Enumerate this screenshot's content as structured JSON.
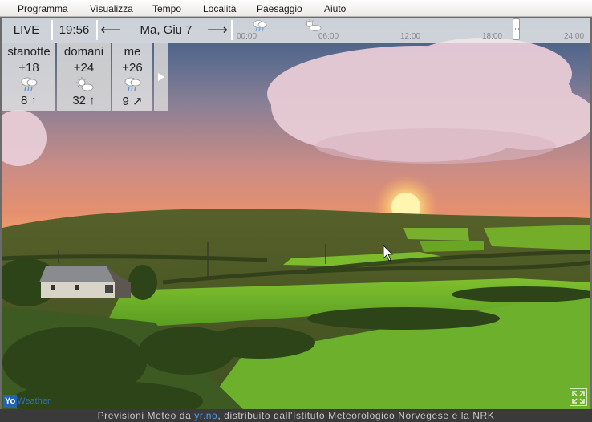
{
  "menu": [
    "Programma",
    "Visualizza",
    "Tempo",
    "Località",
    "Paesaggio",
    "Aiuto"
  ],
  "timebar": {
    "live_label": "LIVE",
    "clock": "19:56",
    "date": "Ma, Giu 7",
    "ticks": [
      "00:00",
      "06:00",
      "12:00",
      "18:00",
      "24:00"
    ],
    "icons": [
      "rain-cloud-icon",
      "sun-cloud-icon"
    ]
  },
  "forecast": [
    {
      "name": "stanotte",
      "temp": "+18",
      "icon": "rain-cloud-icon",
      "wind": "8 ↑"
    },
    {
      "name": "domani",
      "temp": "+24",
      "icon": "sun-cloud-icon",
      "wind": "32 ↑"
    },
    {
      "name": "me",
      "temp": "+26",
      "icon": "rain-cloud-icon",
      "wind": "9 ↗"
    }
  ],
  "logo": {
    "short": "Yo",
    "rest": "Weather"
  },
  "status": {
    "prefix": "Previsioni Meteo da",
    "link": "yr.no",
    "suffix": ", distribuito dall'Istituto Meteorologico Norvegese e la NRK"
  },
  "colors": {
    "accent": "#1f64b5",
    "link": "#4f9ee6"
  }
}
